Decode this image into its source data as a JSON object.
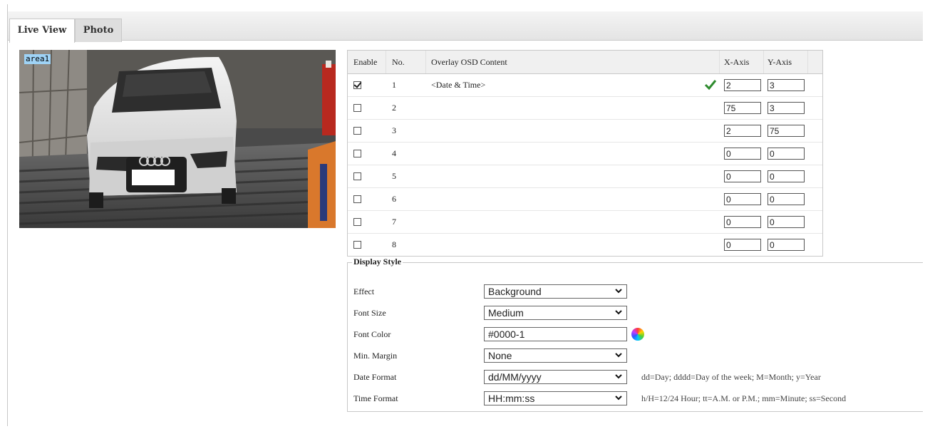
{
  "tabs": [
    {
      "label": "Live View",
      "active": true
    },
    {
      "label": "Photo",
      "active": false
    }
  ],
  "video": {
    "area_label": "area1"
  },
  "osd_table": {
    "headers": {
      "enable": "Enable",
      "no": "No.",
      "content": "Overlay OSD Content",
      "x": "X-Axis",
      "y": "Y-Axis"
    },
    "rows": [
      {
        "enabled": true,
        "no": "1",
        "content": "<Date & Time>",
        "x": "2",
        "y": "3",
        "ok_icon": "checkmark-icon"
      },
      {
        "enabled": false,
        "no": "2",
        "content": "",
        "x": "75",
        "y": "3"
      },
      {
        "enabled": false,
        "no": "3",
        "content": "",
        "x": "2",
        "y": "75"
      },
      {
        "enabled": false,
        "no": "4",
        "content": "",
        "x": "0",
        "y": "0"
      },
      {
        "enabled": false,
        "no": "5",
        "content": "",
        "x": "0",
        "y": "0"
      },
      {
        "enabled": false,
        "no": "6",
        "content": "",
        "x": "0",
        "y": "0"
      },
      {
        "enabled": false,
        "no": "7",
        "content": "",
        "x": "0",
        "y": "0"
      },
      {
        "enabled": false,
        "no": "8",
        "content": "",
        "x": "0",
        "y": "0"
      }
    ]
  },
  "display_style": {
    "legend": "Display Style",
    "effect": {
      "label": "Effect",
      "value": "Background"
    },
    "font_size": {
      "label": "Font Size",
      "value": "Medium"
    },
    "font_color": {
      "label": "Font Color",
      "value": "#0000-1"
    },
    "min_margin": {
      "label": "Min. Margin",
      "value": "None"
    },
    "date_format": {
      "label": "Date Format",
      "value": "dd/MM/yyyy",
      "hint": "dd=Day; dddd=Day of the week; M=Month; y=Year"
    },
    "time_format": {
      "label": "Time Format",
      "value": "HH:mm:ss",
      "hint": "h/H=12/24 Hour; tt=A.M. or P.M.; mm=Minute; ss=Second"
    }
  },
  "colors": {
    "check_green": "#2e8b2e",
    "area_label_bg": "#9fd3f6",
    "tab_bar_bg": "#e8e8e8"
  }
}
